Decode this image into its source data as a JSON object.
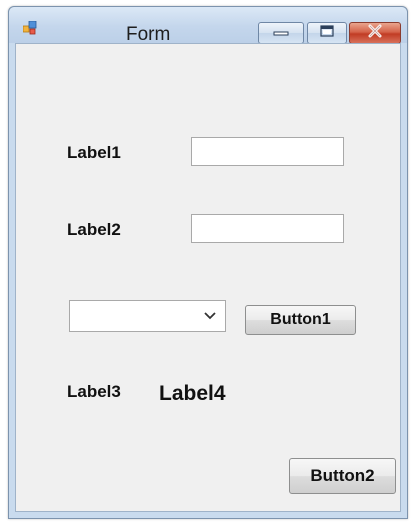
{
  "window": {
    "title": "Form",
    "icon": "winforms-app-icon",
    "controls": {
      "minimize_icon": "minimize-icon",
      "maximize_icon": "maximize-icon",
      "close_icon": "close-icon"
    }
  },
  "form": {
    "label1": "Label1",
    "label2": "Label2",
    "textbox1_value": "",
    "textbox2_value": "",
    "combo_value": "",
    "combo_icon": "chevron-down-icon",
    "button1": "Button1",
    "label3": "Label3",
    "label4": "Label4",
    "button2": "Button2"
  },
  "colors": {
    "title_bar": "#c4d6ec",
    "client_background": "#f0f0f0",
    "close_button": "#c13c24"
  }
}
